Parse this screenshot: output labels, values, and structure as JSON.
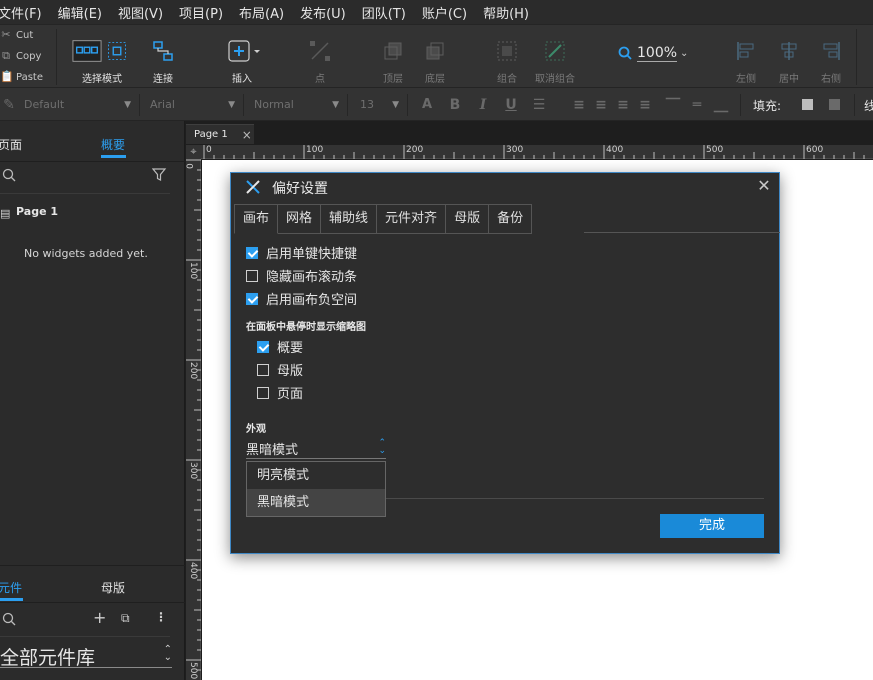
{
  "menu": [
    "文件(F)",
    "编辑(E)",
    "视图(V)",
    "项目(P)",
    "布局(A)",
    "发布(U)",
    "团队(T)",
    "账户(C)",
    "帮助(H)"
  ],
  "clipboard": {
    "cut": "Cut",
    "copy": "Copy",
    "paste": "Paste"
  },
  "toolbar": {
    "select_mode": "选择模式",
    "connect": "连接",
    "insert": "插入",
    "point": "点",
    "top": "顶层",
    "bottom": "底层",
    "group": "组合",
    "ungroup": "取消组合",
    "zoom": "100%",
    "left": "左侧",
    "center": "居中",
    "right": "右侧"
  },
  "format": {
    "style": "Default",
    "font": "Arial",
    "weight": "Normal",
    "size": "13",
    "fill_label": "填充:",
    "line_label": "线"
  },
  "left_panel": {
    "tabs": [
      "页面",
      "概要"
    ],
    "active_tab": "概要",
    "page_item": "Page 1",
    "empty_text": "No widgets added yet.",
    "bottom_tabs": [
      "元件",
      "母版"
    ],
    "library": "全部元件库"
  },
  "canvas": {
    "doc_tab": "Page 1",
    "hruler": [
      "0",
      "100",
      "200",
      "300",
      "400",
      "500",
      "600"
    ],
    "vruler": [
      "0",
      "100",
      "200",
      "300",
      "400",
      "500"
    ]
  },
  "dialog": {
    "title": "偏好设置",
    "tabs": [
      "画布",
      "网格",
      "辅助线",
      "元件对齐",
      "母版",
      "备份"
    ],
    "active_tab": "画布",
    "options": [
      {
        "label": "启用单键快捷键",
        "checked": true
      },
      {
        "label": "隐藏画布滚动条",
        "checked": false
      },
      {
        "label": "启用画布负空间",
        "checked": true
      }
    ],
    "thumb_section": "在面板中悬停时显示缩略图",
    "thumb_options": [
      {
        "label": "概要",
        "checked": true
      },
      {
        "label": "母版",
        "checked": false
      },
      {
        "label": "页面",
        "checked": false
      }
    ],
    "appearance_section": "外观",
    "appearance_value": "黑暗模式",
    "appearance_options": [
      "明亮模式",
      "黑暗模式"
    ],
    "done": "完成"
  },
  "colors": {
    "accent": "#2c9ff0",
    "button": "#1a8ad8",
    "panel": "#2b2b2b",
    "toolbar": "#333333"
  }
}
